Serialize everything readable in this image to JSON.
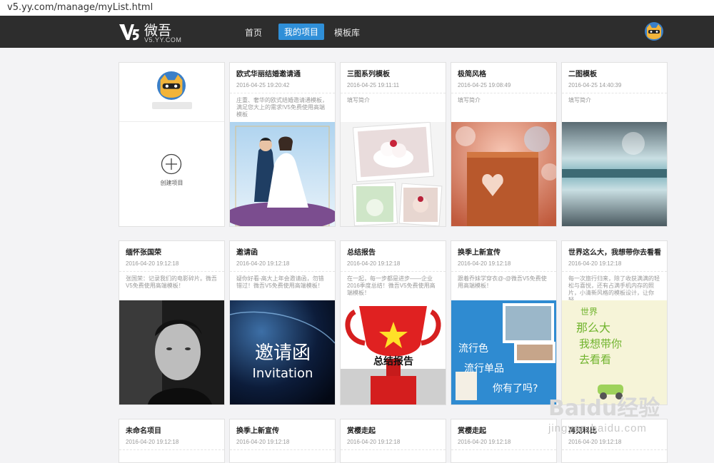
{
  "browser": {
    "url": "v5.yy.com/manage/myList.html"
  },
  "logo": {
    "cn": "微吾",
    "en": "V5.YY.COM"
  },
  "nav": {
    "home": "首页",
    "my_projects": "我的项目",
    "templates": "模板库"
  },
  "create": {
    "label": "创建项目"
  },
  "projects": [
    {
      "title": "欧式华丽结婚邀请通",
      "date": "2016-04-25 19:20:42",
      "desc": "庄重、奢华的欧式结婚邀请通模板，满足您大上的需求!V5免费使用高端模板"
    },
    {
      "title": "三图系列模板",
      "date": "2016-04-25 19:11:11",
      "desc": "填写简介"
    },
    {
      "title": "极简风格",
      "date": "2016-04-25 19:08:49",
      "desc": "填写简介"
    },
    {
      "title": "二图模板",
      "date": "2016-04-25 14:40:39",
      "desc": "填写简介"
    },
    {
      "title": "缅怀张国荣",
      "date": "2016-04-20 19:12:18",
      "desc": "张国荣：记录我们的电影碎片。微吾V5免费使用高端模板！"
    },
    {
      "title": "邀请函",
      "date": "2016-04-20 19:12:18",
      "desc": "疑你好看-高大上年会邀请函，勿错错过！微吾V5免费使用高端模板！"
    },
    {
      "title": "总结报告",
      "date": "2016-04-20 19:12:18",
      "desc": "在一起，每一步都是进步——企业2016季度总结！微吾V5免费使用高端模板！"
    },
    {
      "title": "换季上新宣传",
      "date": "2016-04-20 19:12:18",
      "desc": "跟着乔妹学穿衣@-@微吾V5免费使用高端模板！"
    },
    {
      "title": "世界这么大，我想带你去看看",
      "date": "2016-04-20 19:12:18",
      "desc": "每一次旅行归来，除了收获满满的轻松与喜悦，还有占满手机内存的照片，小清新风格的模板设计，让你轻..."
    },
    {
      "title": "未命名项目",
      "date": "2016-04-20 19:12:18"
    },
    {
      "title": "换季上新宣传",
      "date": "2016-04-20 19:12:18"
    },
    {
      "title": "赏樱走起",
      "date": "2016-04-20 19:12:18"
    },
    {
      "title": "赏樱走起",
      "date": "2016-04-20 19:12:18"
    },
    {
      "title": "再见科比",
      "date": "2016-04-20 19:12:18"
    }
  ],
  "thumb_text": {
    "invitation_cn": "邀请函",
    "invitation_en": "Invitation",
    "report": "总结报告",
    "spring_1": "流行色",
    "spring_2": "流行单品",
    "spring_3": "你有了吗?",
    "travel_1": "世界",
    "travel_2": "那么大",
    "travel_3": "我想带你",
    "travel_4": "去看看"
  },
  "watermark": {
    "brand": "Baidu经验",
    "url": "jingyan.baidu.com"
  },
  "colors": {
    "nav_bg": "#2d2d2d",
    "accent": "#2f8fd8",
    "page_bg": "#f3f3f5"
  }
}
